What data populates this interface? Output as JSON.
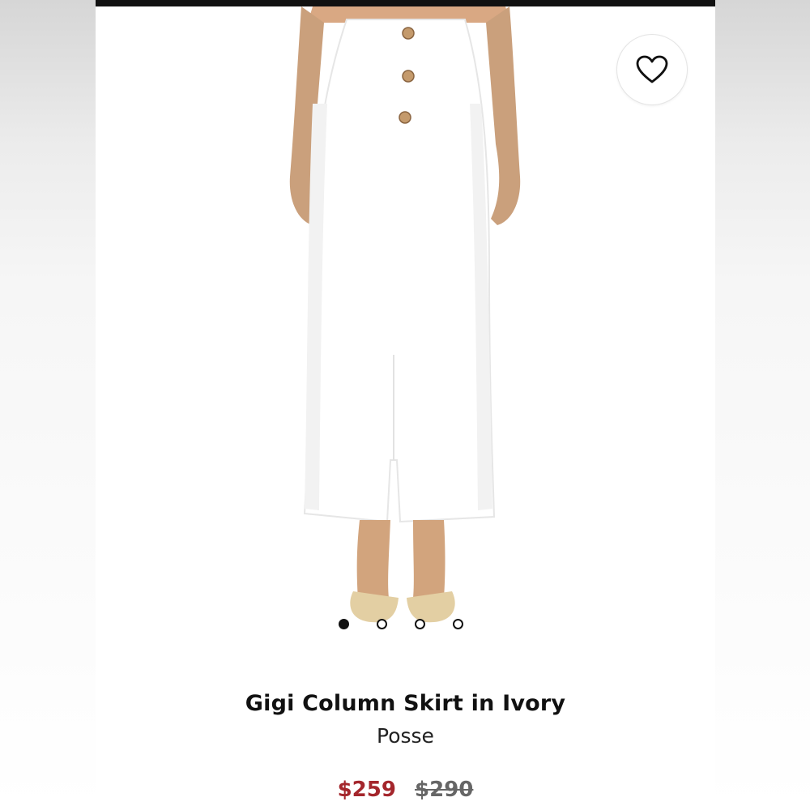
{
  "product": {
    "title": "Gigi Column Skirt in Ivory",
    "brand": "Posse",
    "sale_price": "$259",
    "original_price": "$290",
    "sale_color": "#a4262c"
  },
  "favorite": {
    "icon": "heart-icon"
  },
  "gallery": {
    "image_count": 4,
    "active_index": 0
  }
}
